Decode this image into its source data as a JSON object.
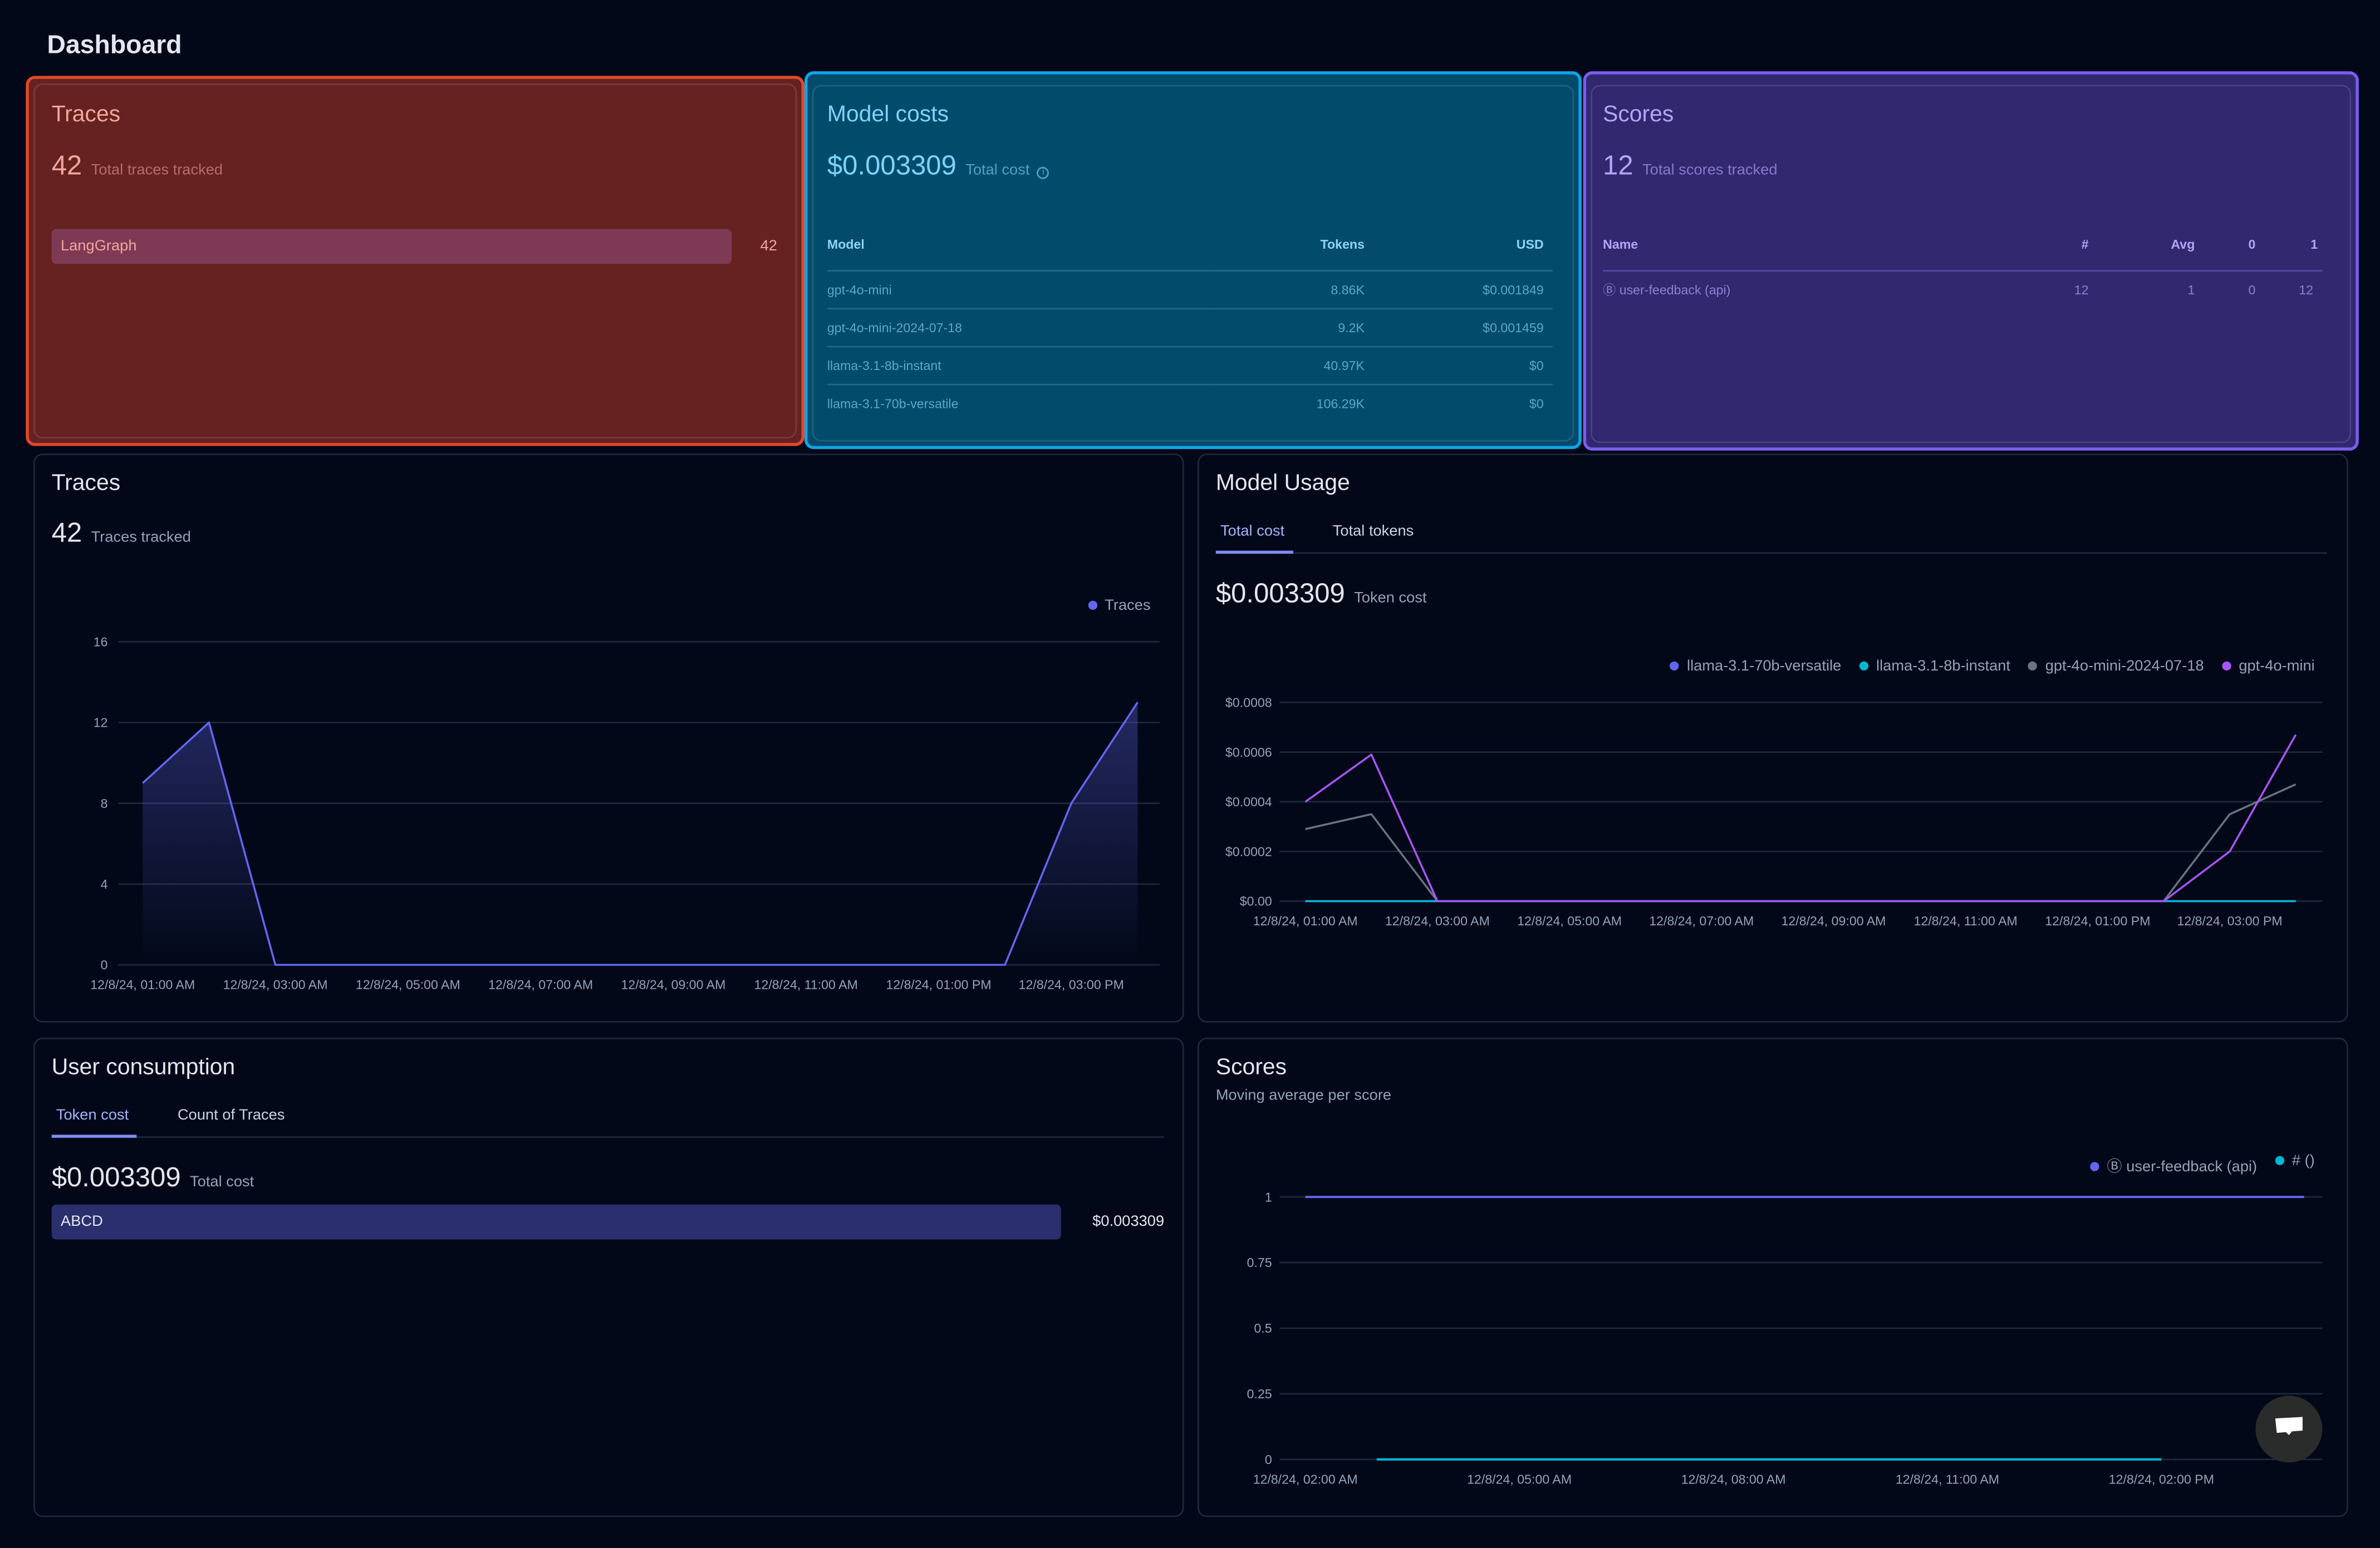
{
  "page_title": "Dashboard",
  "summary_cards": {
    "traces": {
      "title": "Traces",
      "value": "42",
      "label": "Total traces tracked",
      "bars": [
        {
          "name": "LangGraph",
          "value": "42",
          "fraction": 1.0
        }
      ],
      "color": "#e2482a"
    },
    "model_costs": {
      "title": "Model costs",
      "value": "$0.003309",
      "label": "Total cost",
      "info_icon": "info-icon",
      "color": "#0ea5e9",
      "columns": [
        "Model",
        "Tokens",
        "USD"
      ],
      "rows": [
        [
          "gpt-4o-mini",
          "8.86K",
          "$0.001849"
        ],
        [
          "gpt-4o-mini-2024-07-18",
          "9.2K",
          "$0.001459"
        ],
        [
          "llama-3.1-8b-instant",
          "40.97K",
          "$0"
        ],
        [
          "llama-3.1-70b-versatile",
          "106.29K",
          "$0"
        ]
      ]
    },
    "scores": {
      "title": "Scores",
      "value": "12",
      "label": "Total scores tracked",
      "color": "#7c5cf0",
      "columns": [
        "Name",
        "#",
        "Avg",
        "0",
        "1"
      ],
      "rows": [
        [
          "Ⓑ user-feedback (api)",
          "12",
          "1",
          "0",
          "12"
        ]
      ]
    }
  },
  "traces_panel": {
    "title": "Traces",
    "value": "42",
    "label": "Traces tracked"
  },
  "model_usage_panel": {
    "title": "Model Usage",
    "tabs": [
      "Total cost",
      "Total tokens"
    ],
    "active_tab": "Total cost",
    "value": "$0.003309",
    "label": "Token cost"
  },
  "user_consumption_panel": {
    "title": "User consumption",
    "tabs": [
      "Token cost",
      "Count of Traces"
    ],
    "active_tab": "Token cost",
    "value": "$0.003309",
    "label": "Total cost",
    "bars": [
      {
        "name": "ABCD",
        "value": "$0.003309",
        "fraction": 1.0
      }
    ]
  },
  "scores_panel": {
    "title": "Scores",
    "subtitle": "Moving average per score"
  },
  "chat_button": {
    "icon": "chat-bubble-icon"
  },
  "chart_data": [
    {
      "id": "traces",
      "type": "area",
      "x": [
        "12/8/24, 01:00 AM",
        "12/8/24, 02:00 AM",
        "12/8/24, 03:00 AM",
        "12/8/24, 04:00 AM",
        "12/8/24, 05:00 AM",
        "12/8/24, 06:00 AM",
        "12/8/24, 07:00 AM",
        "12/8/24, 08:00 AM",
        "12/8/24, 09:00 AM",
        "12/8/24, 10:00 AM",
        "12/8/24, 11:00 AM",
        "12/8/24, 12:00 PM",
        "12/8/24, 01:00 PM",
        "12/8/24, 02:00 PM",
        "12/8/24, 03:00 PM",
        "12/8/24, 04:00 PM"
      ],
      "x_ticks": [
        "12/8/24, 01:00 AM",
        "12/8/24, 03:00 AM",
        "12/8/24, 05:00 AM",
        "12/8/24, 07:00 AM",
        "12/8/24, 09:00 AM",
        "12/8/24, 11:00 AM",
        "12/8/24, 01:00 PM",
        "12/8/24, 03:00 PM"
      ],
      "y_ticks": [
        "0",
        "4",
        "8",
        "12",
        "16"
      ],
      "ylim": [
        0,
        16
      ],
      "grid": true,
      "legend": "top-right",
      "series": [
        {
          "name": "Traces",
          "color": "#6366f1",
          "values": [
            9,
            12,
            0,
            0,
            0,
            0,
            0,
            0,
            0,
            0,
            0,
            0,
            0,
            0,
            8,
            13
          ]
        }
      ]
    },
    {
      "id": "model_usage",
      "type": "line",
      "x": [
        "12/8/24, 01:00 AM",
        "12/8/24, 02:00 AM",
        "12/8/24, 03:00 AM",
        "12/8/24, 04:00 AM",
        "12/8/24, 05:00 AM",
        "12/8/24, 06:00 AM",
        "12/8/24, 07:00 AM",
        "12/8/24, 08:00 AM",
        "12/8/24, 09:00 AM",
        "12/8/24, 10:00 AM",
        "12/8/24, 11:00 AM",
        "12/8/24, 12:00 PM",
        "12/8/24, 01:00 PM",
        "12/8/24, 02:00 PM",
        "12/8/24, 03:00 PM",
        "12/8/24, 04:00 PM"
      ],
      "x_ticks": [
        "12/8/24, 01:00 AM",
        "12/8/24, 03:00 AM",
        "12/8/24, 05:00 AM",
        "12/8/24, 07:00 AM",
        "12/8/24, 09:00 AM",
        "12/8/24, 11:00 AM",
        "12/8/24, 01:00 PM",
        "12/8/24, 03:00 PM"
      ],
      "y_ticks": [
        "$0.00",
        "$0.0002",
        "$0.0004",
        "$0.0006",
        "$0.0008"
      ],
      "ylim": [
        0,
        0.0008
      ],
      "grid": true,
      "legend": "top-right",
      "series": [
        {
          "name": "llama-3.1-70b-versatile",
          "color": "#6366f1",
          "values": [
            0,
            0,
            0,
            0,
            0,
            0,
            0,
            0,
            0,
            0,
            0,
            0,
            0,
            0,
            0,
            0
          ]
        },
        {
          "name": "llama-3.1-8b-instant",
          "color": "#06b6d4",
          "values": [
            0,
            0,
            0,
            0,
            0,
            0,
            0,
            0,
            0,
            0,
            0,
            0,
            0,
            0,
            0,
            0
          ]
        },
        {
          "name": "gpt-4o-mini-2024-07-18",
          "color": "#6b7280",
          "values": [
            0.00029,
            0.00035,
            0,
            0,
            0,
            0,
            0,
            0,
            0,
            0,
            0,
            0,
            0,
            0,
            0.00035,
            0.00047
          ]
        },
        {
          "name": "gpt-4o-mini",
          "color": "#a855f7",
          "values": [
            0.0004,
            0.00059,
            0,
            0,
            0,
            0,
            0,
            0,
            0,
            0,
            0,
            0,
            0,
            0,
            0.0002,
            0.00067
          ]
        }
      ]
    },
    {
      "id": "scores",
      "type": "line",
      "x": [
        "12/8/24, 02:00 AM",
        "12/8/24, 03:00 AM",
        "12/8/24, 04:00 AM",
        "12/8/24, 05:00 AM",
        "12/8/24, 06:00 AM",
        "12/8/24, 07:00 AM",
        "12/8/24, 08:00 AM",
        "12/8/24, 09:00 AM",
        "12/8/24, 10:00 AM",
        "12/8/24, 11:00 AM",
        "12/8/24, 12:00 PM",
        "12/8/24, 01:00 PM",
        "12/8/24, 02:00 PM",
        "12/8/24, 03:00 PM",
        "12/8/24, 04:00 PM"
      ],
      "x_ticks": [
        "12/8/24, 02:00 AM",
        "12/8/24, 05:00 AM",
        "12/8/24, 08:00 AM",
        "12/8/24, 11:00 AM",
        "12/8/24, 02:00 PM"
      ],
      "y_ticks": [
        "0",
        "0.25",
        "0.5",
        "0.75",
        "1"
      ],
      "ylim": [
        0,
        1
      ],
      "grid": true,
      "legend": "top-right",
      "series": [
        {
          "name": "Ⓑ user-feedback (api)",
          "color": "#6366f1",
          "values": [
            1,
            1,
            1,
            1,
            1,
            1,
            1,
            1,
            1,
            1,
            1,
            1,
            1,
            1,
            1
          ]
        },
        {
          "name": "# ()",
          "color": "#06b6d4",
          "values": [
            null,
            0,
            0,
            0,
            0,
            0,
            0,
            0,
            0,
            0,
            0,
            0,
            0,
            null,
            null
          ]
        }
      ]
    }
  ]
}
